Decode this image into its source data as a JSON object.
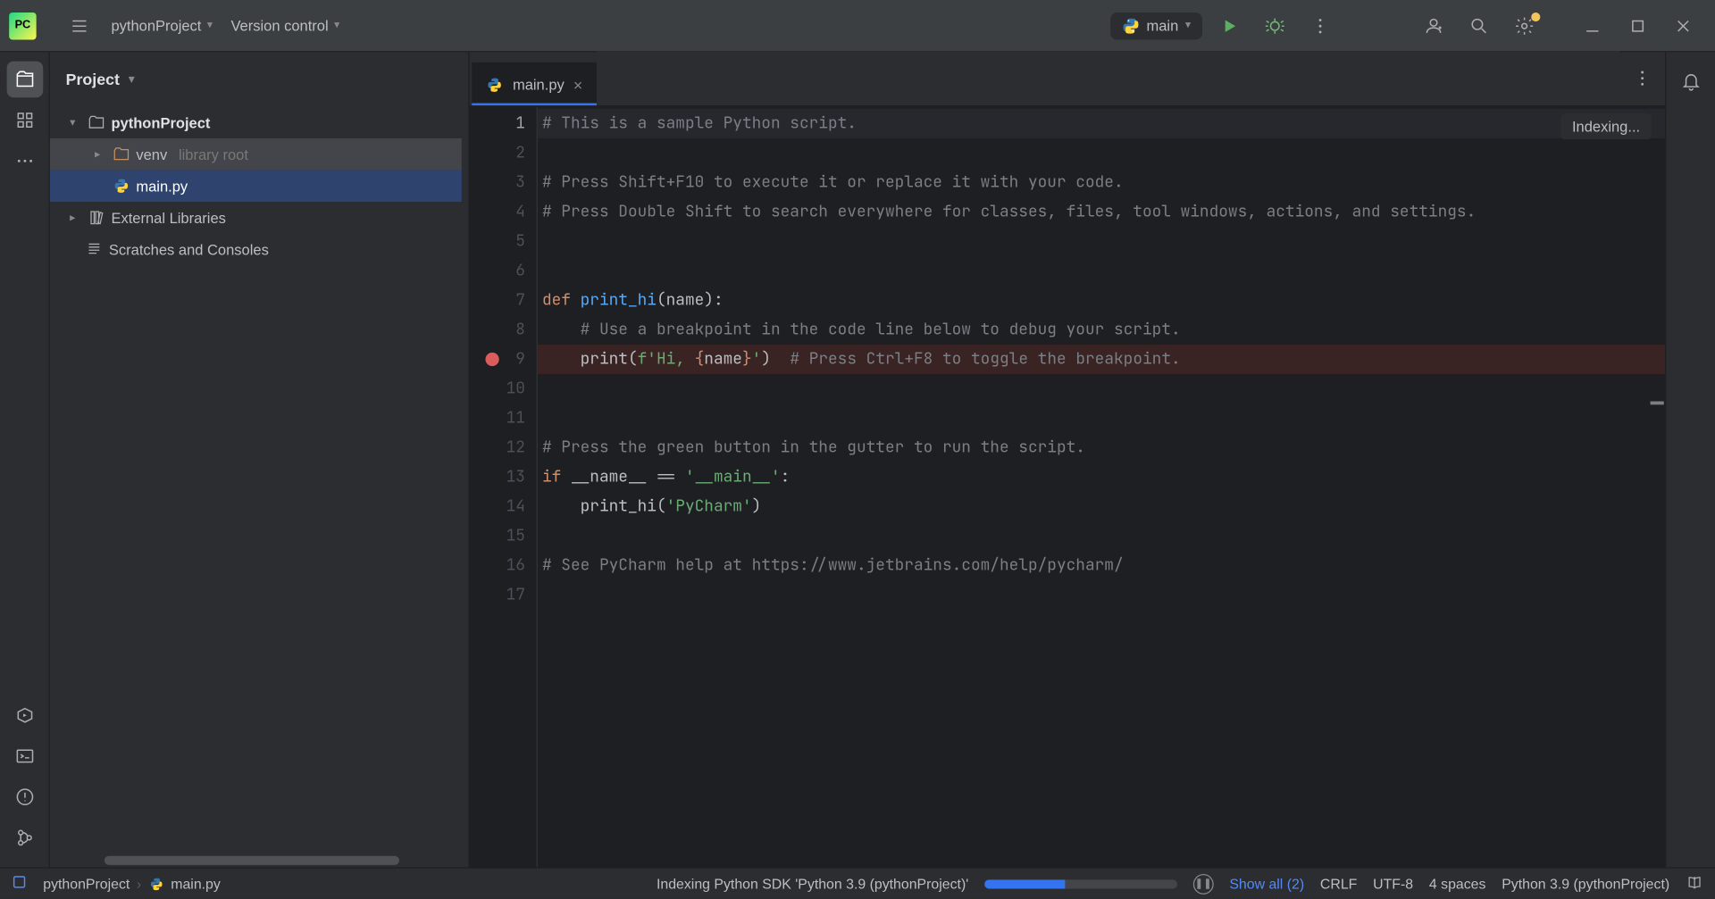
{
  "titlebar": {
    "project_name": "pythonProject",
    "vcs_label": "Version control",
    "run_config": "main"
  },
  "project_panel": {
    "title": "Project",
    "root": "pythonProject",
    "venv": "venv",
    "venv_hint": "library root",
    "file_main": "main.py",
    "ext_libs": "External Libraries",
    "scratches": "Scratches and Consoles"
  },
  "tab": {
    "file": "main.py"
  },
  "editor": {
    "indexing_label": "Indexing...",
    "breakpoint_line": 9,
    "current_line": 1,
    "lines": {
      "l1": "# This is a sample Python script.",
      "l3": "# Press Shift+F10 to execute it or replace it with your code.",
      "l4": "# Press Double Shift to search everywhere for classes, files, tool windows, actions, and settings.",
      "l7_def": "def ",
      "l7_fn": "print_hi",
      "l7_rest": "(name):",
      "l8": "    # Use a breakpoint in the code line below to debug your script.",
      "l9_call": "    print(",
      "l9_f": "f'Hi, ",
      "l9_brace_open": "{",
      "l9_name": "name",
      "l9_brace_close": "}",
      "l9_endstr": "'",
      "l9_close": ")  ",
      "l9_comment": "# Press Ctrl+F8 to toggle the breakpoint.",
      "l12": "# Press the green button in the gutter to run the script.",
      "l13_if": "if ",
      "l13_name": "__name__ == ",
      "l13_str": "'__main__'",
      "l13_colon": ":",
      "l14_call": "    print_hi(",
      "l14_str": "'PyCharm'",
      "l14_close": ")",
      "l16": "# See PyCharm help at https://www.jetbrains.com/help/pycharm/"
    }
  },
  "statusbar": {
    "crumb_project": "pythonProject",
    "crumb_file": "main.py",
    "indexing_text": "Indexing Python SDK 'Python 3.9 (pythonProject)'",
    "show_all": "Show all (2)",
    "line_sep": "CRLF",
    "encoding": "UTF-8",
    "indent": "4 spaces",
    "interpreter": "Python 3.9 (pythonProject)"
  },
  "icons": {
    "logo_text": "PC"
  }
}
